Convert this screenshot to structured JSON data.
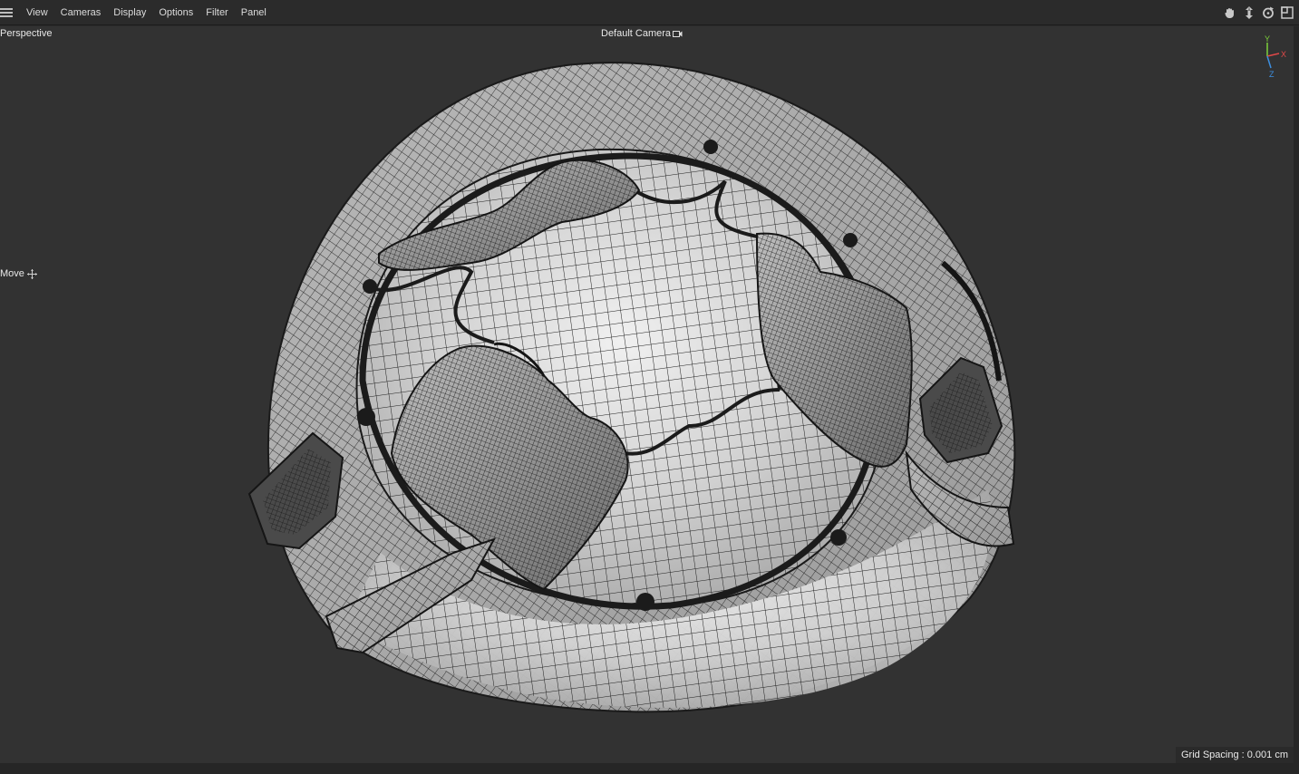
{
  "menu": {
    "items": [
      "View",
      "Cameras",
      "Display",
      "Options",
      "Filter",
      "Panel"
    ]
  },
  "toolbar_icons": [
    "hand-pan-icon",
    "move-arrows-icon",
    "rotate-icon",
    "maximize-view-icon"
  ],
  "viewport": {
    "projection_label": "Perspective",
    "camera_label": "Default Camera",
    "tool_label": "Move",
    "grid_spacing": "Grid Spacing : 0.001 cm"
  },
  "axis_gizmo": {
    "x": "X",
    "y": "Y",
    "z": "Z",
    "x_color": "#e04848",
    "y_color": "#7ccf3a",
    "z_color": "#3d8fe0"
  },
  "colors": {
    "viewport_bg": "#323232",
    "mesh_fill_light": "#d0d0d0",
    "mesh_line": "#1e1e1e"
  }
}
